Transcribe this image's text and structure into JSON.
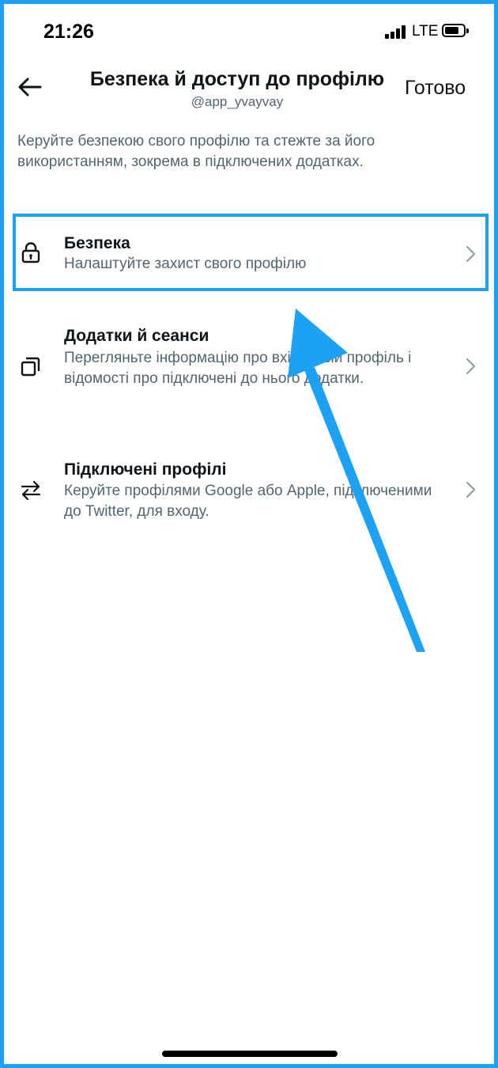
{
  "status_bar": {
    "time": "21:26",
    "network": "LTE",
    "icons": [
      "signal-icon",
      "battery-icon"
    ]
  },
  "header": {
    "back_icon": "arrow-left-icon",
    "title": "Безпека й доступ до профілю",
    "subtitle": "@app_yvayvay",
    "done_label": "Готово"
  },
  "description": "Керуйте безпекою свого профілю та стежте за його використанням, зокрема в підключених додатках.",
  "menu": {
    "items": [
      {
        "icon": "lock-icon",
        "title": "Безпека",
        "subtitle": "Налаштуйте захист свого профілю",
        "highlighted": true
      },
      {
        "icon": "apps-icon",
        "title": "Додатки й сеанси",
        "subtitle": "Перегляньте інформацію про вхід у свій профіль і відомості про підключені до нього додатки."
      },
      {
        "icon": "swap-arrows-icon",
        "title": "Підключені профілі",
        "subtitle": "Керуйте профілями Google або Apple, підключеними до Twitter, для входу."
      }
    ]
  },
  "colors": {
    "accent": "#1da1f2",
    "text_primary": "#0f1419",
    "text_secondary": "#536471",
    "chevron": "#8b98a5"
  }
}
